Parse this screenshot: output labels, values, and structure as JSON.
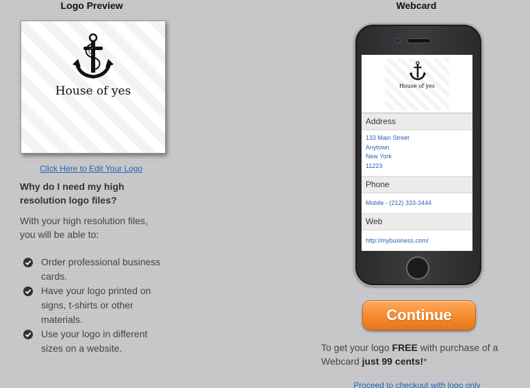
{
  "left": {
    "title": "Logo Preview",
    "logo_brand_text": "House of yes",
    "edit_link": "Click Here to Edit Your Logo",
    "why_heading": "Why do I need my high resolution logo files?",
    "intro": "With your high resolution files, you will be able to:",
    "bullets": [
      {
        "text": "Order professional business cards.",
        "icon": "check-circle-icon"
      },
      {
        "text": "Have your logo printed on signs, t-shirts or other materials.",
        "icon": "check-circle-icon"
      },
      {
        "text": "Use your logo in different sizes on a website.",
        "icon": "check-circle-icon"
      }
    ]
  },
  "right": {
    "title": "Webcard",
    "card": {
      "brand_text": "House of yes",
      "address_label": "Address",
      "address_lines": [
        "133 Main Street",
        "Anytown",
        "New York",
        "11223"
      ],
      "phone_label": "Phone",
      "phone_value": "Mobile - (212) 333-3444",
      "web_label": "Web",
      "web_value": "http://mybusiness.com/"
    },
    "continue_label": "Continue",
    "promo": {
      "part1": "To get your logo ",
      "free": "FREE",
      "part2": " with purchase of a Webcard ",
      "price": "just 99 cents!",
      "part3": "*"
    },
    "checkout_link": "Proceed to checkout with logo only"
  },
  "colors": {
    "background": "#c9c9cb",
    "link": "#1f64b8",
    "continue_button": "#f48a2e",
    "card_link_text": "#2a62b5"
  }
}
